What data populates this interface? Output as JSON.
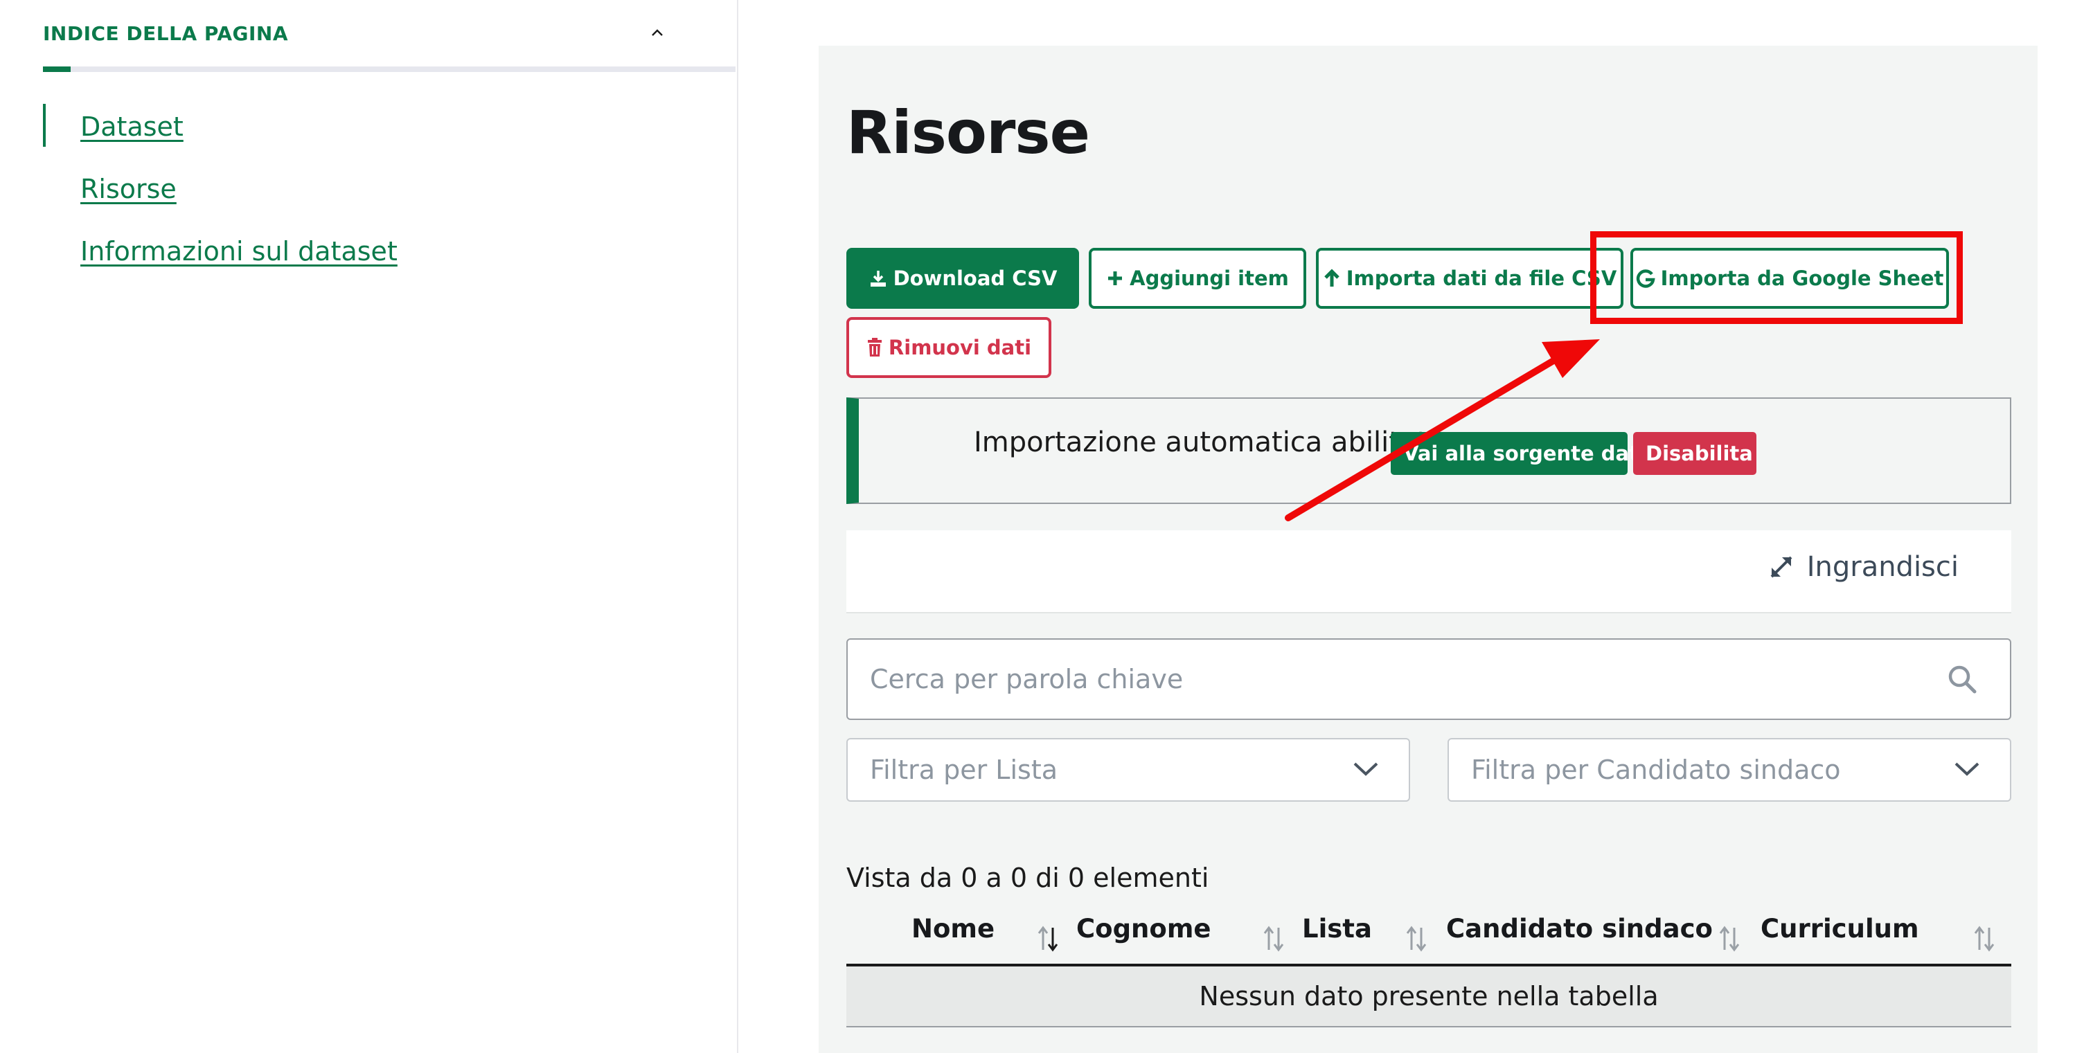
{
  "sidebar": {
    "title": "INDICE DELLA PAGINA",
    "progress_fraction": 0.04,
    "items": [
      {
        "label": "Dataset",
        "active": true
      },
      {
        "label": "Risorse",
        "active": false
      },
      {
        "label": "Informazioni sul dataset",
        "active": false
      }
    ]
  },
  "main": {
    "title": "Risorse",
    "buttons": {
      "download_csv": "Download CSV",
      "add_item": "Aggiungi item",
      "import_csv": "Importa dati da file CSV",
      "import_google": "Importa da Google Sheet",
      "remove_data": "Rimuovi dati"
    },
    "auto_import": {
      "text": "Importazione automatica abilitata",
      "source_label": "Vai alla sorgente dati",
      "disable_label": "Disabilita"
    },
    "expand_label": "Ingrandisci",
    "search": {
      "placeholder": "Cerca per parola chiave"
    },
    "filters": {
      "lista_placeholder": "Filtra per Lista",
      "candidato_placeholder": "Filtra per Candidato sindaco"
    },
    "results_info": "Vista da 0 a 0 di 0 elementi",
    "table": {
      "columns": [
        "Nome",
        "Cognome",
        "Lista",
        "Candidato sindaco",
        "Curriculum"
      ],
      "empty_message": "Nessun dato presente nella tabella"
    }
  },
  "icons": {
    "download": "download-icon",
    "plus": "plus-icon",
    "upload": "arrow-up-icon",
    "google": "google-g-icon",
    "trash": "trash-icon",
    "external": "external-link-icon",
    "close": "close-icon",
    "expand": "expand-icon",
    "search": "search-icon",
    "chevron": "chevron-down-icon",
    "sort": "sort-icon"
  },
  "colors": {
    "brand_green": "#0b7a4b",
    "danger_red": "#d2344c",
    "annotation_red": "#ef0808",
    "panel_bg": "#f3f5f4"
  }
}
